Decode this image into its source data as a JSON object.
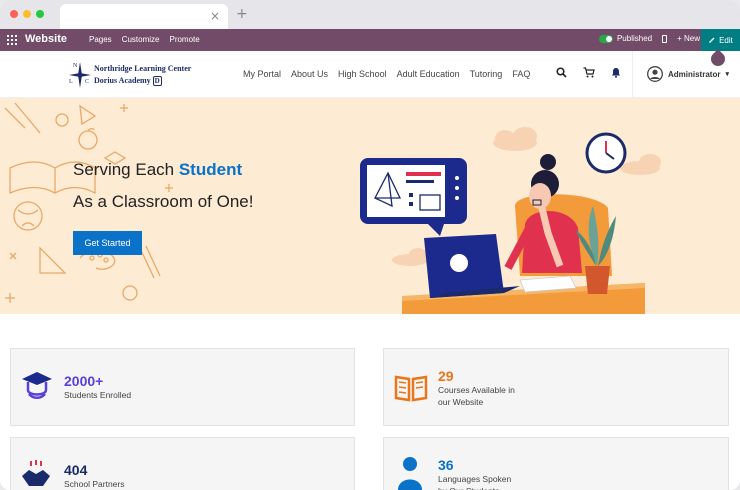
{
  "admin_bar": {
    "title": "Website",
    "menu": [
      "Pages",
      "Customize",
      "Promote"
    ],
    "published_label": "Published",
    "new_label": "+ New",
    "edit_label": "Edit"
  },
  "site": {
    "logo_line1": "Northridge Learning Center",
    "logo_line2": "Dorius Academy",
    "logo_compass_letters": [
      "N",
      "L",
      "C"
    ],
    "logo_mark": "D",
    "nav": [
      "My Portal",
      "About Us",
      "High School",
      "Adult Education",
      "Tutoring",
      "FAQ"
    ],
    "user": "Administrator"
  },
  "hero": {
    "line1_pre": "Serving Each ",
    "line1_accent": "Student",
    "line2": "As a Classroom of One!",
    "cta": "Get Started"
  },
  "stats": [
    {
      "number": "2000+",
      "label": "Students Enrolled",
      "icon": "graduation-cap-icon",
      "color": "#5b3fd8"
    },
    {
      "number": "29",
      "label": "Courses Available in our Website",
      "icon": "open-book-icon",
      "color": "#e8761a"
    },
    {
      "number": "404",
      "label": "School Partners",
      "icon": "handshake-icon",
      "color": "#1d2b6b"
    },
    {
      "number": "36",
      "label": "Languages Spoken by Our Students",
      "icon": "person-icon",
      "color": "#0a72c8"
    }
  ],
  "colors": {
    "admin": "#714b67",
    "edit": "#017e84",
    "accent": "#0a72c8",
    "hero_bg": "#fdebd4"
  }
}
